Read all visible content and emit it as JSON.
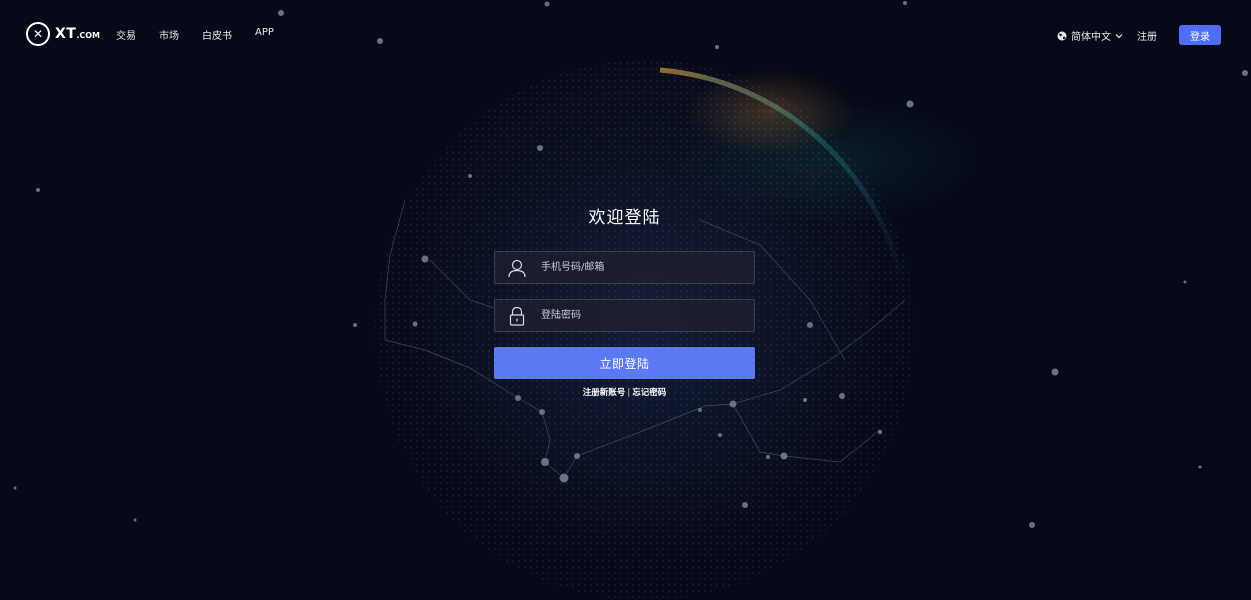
{
  "brand": {
    "logo_text": "XT",
    "logo_suffix": ".COM"
  },
  "nav": {
    "items": [
      {
        "label": "交易"
      },
      {
        "label": "市场"
      },
      {
        "label": "白皮书"
      },
      {
        "label": "APP"
      }
    ]
  },
  "header_right": {
    "language": "简体中文",
    "register_label": "注册",
    "login_label": "登录"
  },
  "login_form": {
    "title": "欢迎登陆",
    "account_placeholder": "手机号码/邮箱",
    "password_placeholder": "登陆密码",
    "submit_label": "立即登陆",
    "register_link": "注册新账号",
    "separator": "|",
    "forgot_link": "忘记密码"
  },
  "colors": {
    "background": "#070a18",
    "accent": "#4f6ef7",
    "submit": "#5a79f3",
    "field_border": "#3a3e52"
  },
  "icons": {
    "logo": "xt-logo-icon",
    "language": "globe-icon",
    "dropdown": "chevron-down-icon",
    "account": "user-icon",
    "password": "lock-icon"
  }
}
